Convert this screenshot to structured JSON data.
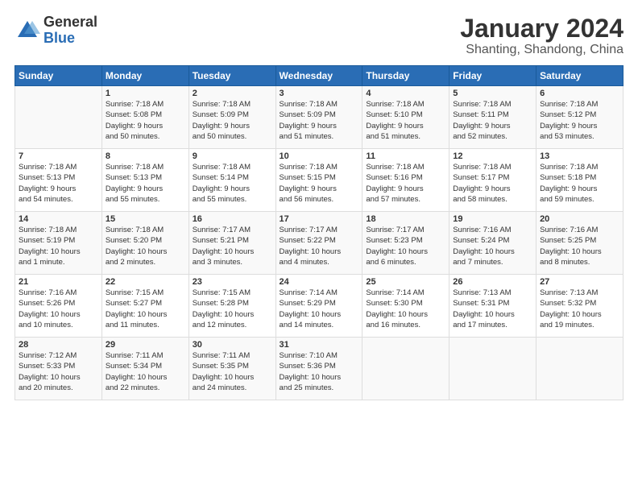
{
  "header": {
    "logo_general": "General",
    "logo_blue": "Blue",
    "month_title": "January 2024",
    "location": "Shanting, Shandong, China"
  },
  "days_of_week": [
    "Sunday",
    "Monday",
    "Tuesday",
    "Wednesday",
    "Thursday",
    "Friday",
    "Saturday"
  ],
  "weeks": [
    [
      {
        "day": "",
        "info": ""
      },
      {
        "day": "1",
        "info": "Sunrise: 7:18 AM\nSunset: 5:08 PM\nDaylight: 9 hours\nand 50 minutes."
      },
      {
        "day": "2",
        "info": "Sunrise: 7:18 AM\nSunset: 5:09 PM\nDaylight: 9 hours\nand 50 minutes."
      },
      {
        "day": "3",
        "info": "Sunrise: 7:18 AM\nSunset: 5:09 PM\nDaylight: 9 hours\nand 51 minutes."
      },
      {
        "day": "4",
        "info": "Sunrise: 7:18 AM\nSunset: 5:10 PM\nDaylight: 9 hours\nand 51 minutes."
      },
      {
        "day": "5",
        "info": "Sunrise: 7:18 AM\nSunset: 5:11 PM\nDaylight: 9 hours\nand 52 minutes."
      },
      {
        "day": "6",
        "info": "Sunrise: 7:18 AM\nSunset: 5:12 PM\nDaylight: 9 hours\nand 53 minutes."
      }
    ],
    [
      {
        "day": "7",
        "info": "Sunrise: 7:18 AM\nSunset: 5:13 PM\nDaylight: 9 hours\nand 54 minutes."
      },
      {
        "day": "8",
        "info": "Sunrise: 7:18 AM\nSunset: 5:13 PM\nDaylight: 9 hours\nand 55 minutes."
      },
      {
        "day": "9",
        "info": "Sunrise: 7:18 AM\nSunset: 5:14 PM\nDaylight: 9 hours\nand 55 minutes."
      },
      {
        "day": "10",
        "info": "Sunrise: 7:18 AM\nSunset: 5:15 PM\nDaylight: 9 hours\nand 56 minutes."
      },
      {
        "day": "11",
        "info": "Sunrise: 7:18 AM\nSunset: 5:16 PM\nDaylight: 9 hours\nand 57 minutes."
      },
      {
        "day": "12",
        "info": "Sunrise: 7:18 AM\nSunset: 5:17 PM\nDaylight: 9 hours\nand 58 minutes."
      },
      {
        "day": "13",
        "info": "Sunrise: 7:18 AM\nSunset: 5:18 PM\nDaylight: 9 hours\nand 59 minutes."
      }
    ],
    [
      {
        "day": "14",
        "info": "Sunrise: 7:18 AM\nSunset: 5:19 PM\nDaylight: 10 hours\nand 1 minute."
      },
      {
        "day": "15",
        "info": "Sunrise: 7:18 AM\nSunset: 5:20 PM\nDaylight: 10 hours\nand 2 minutes."
      },
      {
        "day": "16",
        "info": "Sunrise: 7:17 AM\nSunset: 5:21 PM\nDaylight: 10 hours\nand 3 minutes."
      },
      {
        "day": "17",
        "info": "Sunrise: 7:17 AM\nSunset: 5:22 PM\nDaylight: 10 hours\nand 4 minutes."
      },
      {
        "day": "18",
        "info": "Sunrise: 7:17 AM\nSunset: 5:23 PM\nDaylight: 10 hours\nand 6 minutes."
      },
      {
        "day": "19",
        "info": "Sunrise: 7:16 AM\nSunset: 5:24 PM\nDaylight: 10 hours\nand 7 minutes."
      },
      {
        "day": "20",
        "info": "Sunrise: 7:16 AM\nSunset: 5:25 PM\nDaylight: 10 hours\nand 8 minutes."
      }
    ],
    [
      {
        "day": "21",
        "info": "Sunrise: 7:16 AM\nSunset: 5:26 PM\nDaylight: 10 hours\nand 10 minutes."
      },
      {
        "day": "22",
        "info": "Sunrise: 7:15 AM\nSunset: 5:27 PM\nDaylight: 10 hours\nand 11 minutes."
      },
      {
        "day": "23",
        "info": "Sunrise: 7:15 AM\nSunset: 5:28 PM\nDaylight: 10 hours\nand 12 minutes."
      },
      {
        "day": "24",
        "info": "Sunrise: 7:14 AM\nSunset: 5:29 PM\nDaylight: 10 hours\nand 14 minutes."
      },
      {
        "day": "25",
        "info": "Sunrise: 7:14 AM\nSunset: 5:30 PM\nDaylight: 10 hours\nand 16 minutes."
      },
      {
        "day": "26",
        "info": "Sunrise: 7:13 AM\nSunset: 5:31 PM\nDaylight: 10 hours\nand 17 minutes."
      },
      {
        "day": "27",
        "info": "Sunrise: 7:13 AM\nSunset: 5:32 PM\nDaylight: 10 hours\nand 19 minutes."
      }
    ],
    [
      {
        "day": "28",
        "info": "Sunrise: 7:12 AM\nSunset: 5:33 PM\nDaylight: 10 hours\nand 20 minutes."
      },
      {
        "day": "29",
        "info": "Sunrise: 7:11 AM\nSunset: 5:34 PM\nDaylight: 10 hours\nand 22 minutes."
      },
      {
        "day": "30",
        "info": "Sunrise: 7:11 AM\nSunset: 5:35 PM\nDaylight: 10 hours\nand 24 minutes."
      },
      {
        "day": "31",
        "info": "Sunrise: 7:10 AM\nSunset: 5:36 PM\nDaylight: 10 hours\nand 25 minutes."
      },
      {
        "day": "",
        "info": ""
      },
      {
        "day": "",
        "info": ""
      },
      {
        "day": "",
        "info": ""
      }
    ]
  ]
}
